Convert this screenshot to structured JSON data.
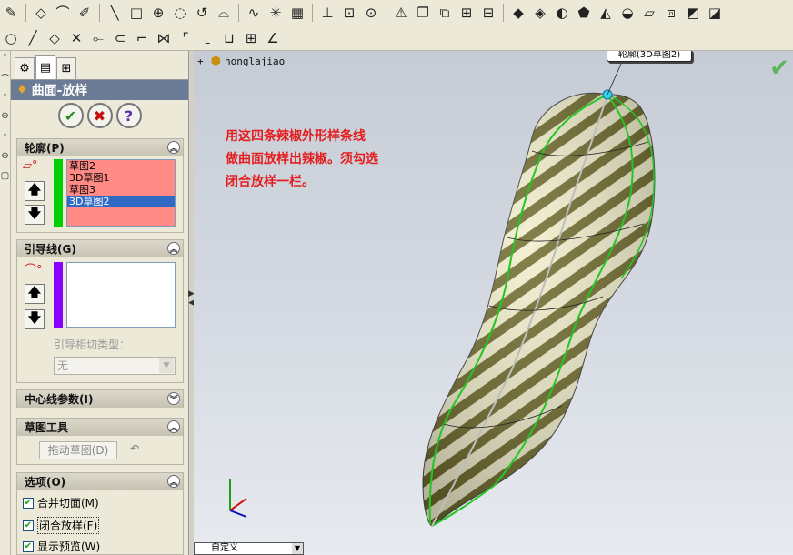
{
  "toolbar_top": {
    "icons": [
      "sketch-icon",
      "smart-dimension-icon",
      "line-icon",
      "rectangle-icon",
      "circle-icon",
      "arc-icon",
      "spline-icon",
      "point-icon",
      "centerline-icon",
      "offset-icon",
      "mirror-icon",
      "trim-icon",
      "surface-icon"
    ]
  },
  "property_manager": {
    "title": "曲面-放样",
    "ok_label": "✔",
    "cancel_label": "✖",
    "help_label": "?",
    "profiles": {
      "header": "轮廓(P)",
      "items": [
        "草图2",
        "3D草图1",
        "草图3",
        "3D草图2"
      ],
      "selected_index": 3
    },
    "guides": {
      "header": "引导线(G)",
      "items": [],
      "tangency_label": "引导相切类型：",
      "tangency_value": "无"
    },
    "centerline": {
      "header": "中心线参数(I)"
    },
    "sketch_tools": {
      "header": "草图工具",
      "drag_label": "拖动草图(D)"
    },
    "options": {
      "header": "选项(O)",
      "merge_label": "合并切面(M)",
      "merge_checked": true,
      "close_label": "闭合放样(F)",
      "close_checked": true,
      "preview_label": "显示预览(W)",
      "preview_checked": true
    }
  },
  "viewport": {
    "tree_label": "honglajiao",
    "tree_expander": "+",
    "note_line1": "用这四条辣椒外形样条线",
    "note_line2": "做曲面放样出辣椒。须勾选",
    "note_line3": "闭合放样一栏。",
    "callout_label": "轮廓(3D草图2)",
    "view_combo": "自定义",
    "ok_check": "✔"
  },
  "colors": {
    "profile_bar": "#00d000",
    "guide_bar": "#8a00ff",
    "title_bar": "#6b7b95",
    "note_text": "#e41e1e"
  }
}
